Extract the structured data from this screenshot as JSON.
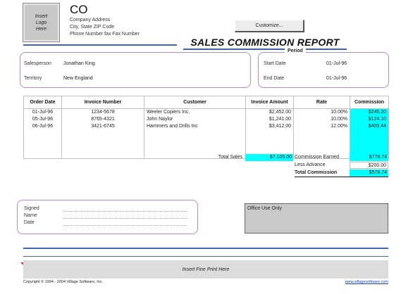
{
  "logo": {
    "line1": "Insert",
    "line2": "Logo",
    "line3": "Here"
  },
  "company": {
    "name": "CO",
    "address": "Company Address",
    "city_state_zip": "City, State ZIP Code",
    "phone_fax": "Phone Number fax Fax Number"
  },
  "customize_label": "Customize...",
  "title": "SALES COMMISSION REPORT",
  "salesperson": {
    "label": "Salesperson",
    "value": "Jonathan King"
  },
  "territory": {
    "label": "Territory",
    "value": "New England"
  },
  "period": {
    "heading": "Period",
    "start_label": "Start Date",
    "start_value": "01-Jul-96",
    "end_label": "End Date",
    "end_value": "01-Jul-96"
  },
  "table": {
    "headers": [
      "Order Date",
      "Invoice Number",
      "Customer",
      "Invoice Amount",
      "Rate",
      "Commission"
    ],
    "rows": [
      [
        "01-Jul-96",
        "1234-5678",
        "Weeler Copiers Inc.",
        "$2,452.00",
        "10.00%",
        "$245.20"
      ],
      [
        "05-Jul-96",
        "8765-4321",
        "John Naylor",
        "$1,241.00",
        "10.00%",
        "$124.10"
      ],
      [
        "06-Jul-96",
        "3421-6745",
        "Hammers and Drills Inc",
        "$3,412.00",
        "12.00%",
        "$409.44"
      ]
    ]
  },
  "totals": {
    "total_sales_label": "Total Sales",
    "total_sales_value": "$7,105.00",
    "commission_earned_label": "Commission Earned",
    "commission_earned_value": "$778.74",
    "less_advance_label": "Less Advance",
    "less_advance_value": "$200.00",
    "total_commission_label": "Total Commission",
    "total_commission_value": "$578.74"
  },
  "signature": {
    "signed_label": "Signed",
    "name_label": "Name",
    "date_label": "Date"
  },
  "office_use_label": "Office Use Only",
  "fine_print": "Insert Fine Print Here",
  "copyright": "Copyright © 1994 - 2004 Village Software, Inc.",
  "website": "www.villagesoftware.com",
  "colors": {
    "accent_blue": "#3f63b8",
    "highlight_cyan": "#00ffff",
    "panel_border": "#b98ac4"
  }
}
